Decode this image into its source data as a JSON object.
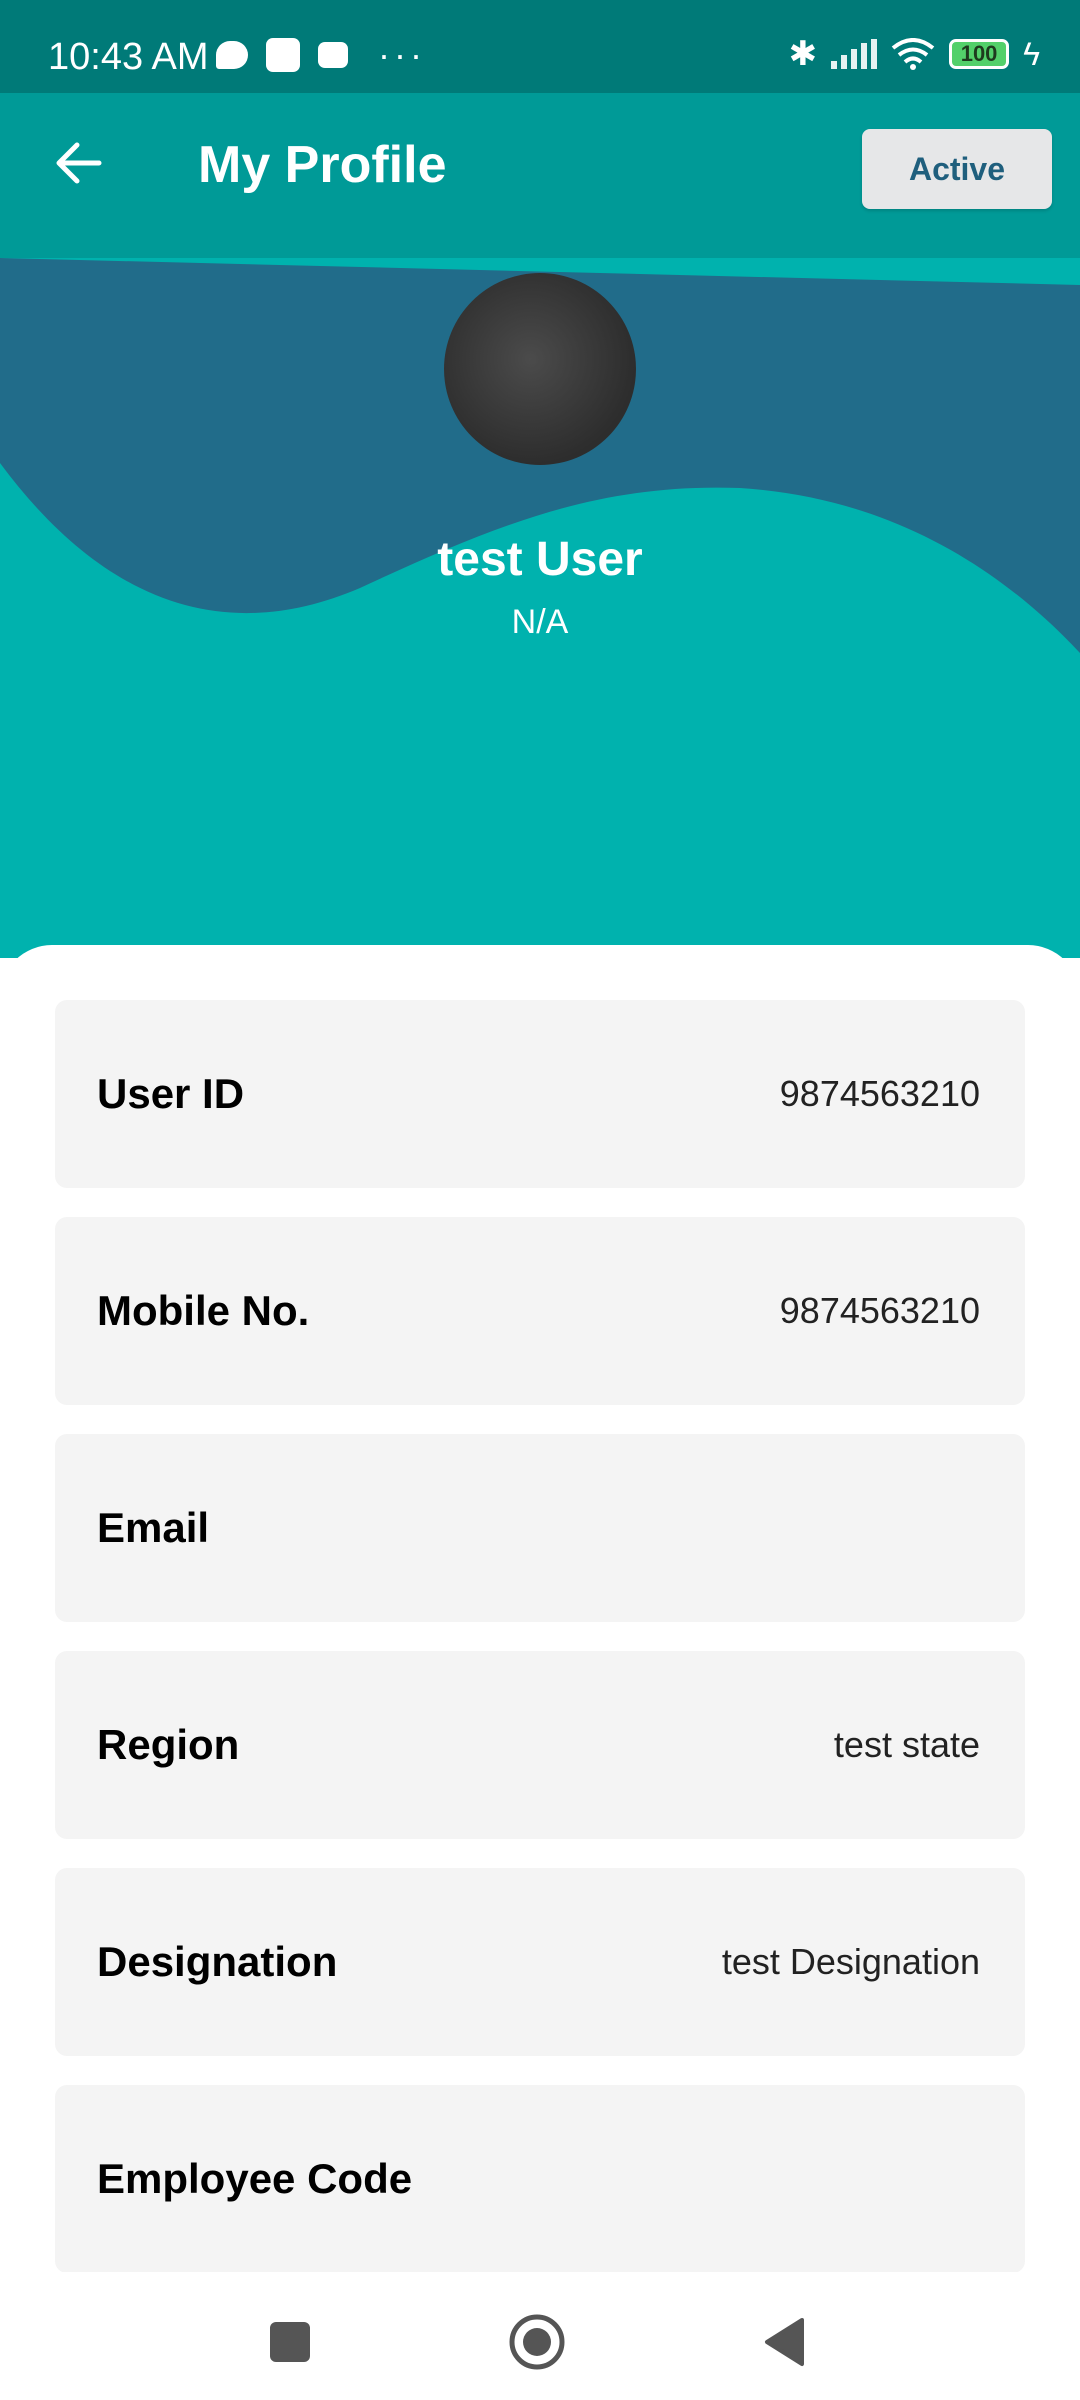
{
  "status_bar": {
    "time": "10:43 AM",
    "battery_level": "100",
    "icons": [
      "chat-bubble-icon",
      "image-icon",
      "calendar-icon",
      "more-dots-icon",
      "bluetooth-icon",
      "signal-icon",
      "wifi-icon",
      "battery-icon",
      "charging-bolt-icon"
    ]
  },
  "app_bar": {
    "title": "My Profile",
    "status_label": "Active",
    "back_icon": "arrow-left-icon"
  },
  "profile": {
    "name": "test User",
    "subtitle": "N/A"
  },
  "fields": [
    {
      "label": "User ID",
      "value": "9874563210"
    },
    {
      "label": "Mobile No.",
      "value": "9874563210"
    },
    {
      "label": "Email",
      "value": ""
    },
    {
      "label": "Region",
      "value": "test state"
    },
    {
      "label": "Designation",
      "value": "test Designation"
    },
    {
      "label": "Employee Code",
      "value": ""
    }
  ],
  "colors": {
    "status_bar": "#007a78",
    "app_bar": "#009a97",
    "teal": "#00b2ae",
    "wave_blue": "#216c8a",
    "chip_text": "#1f5f7d"
  },
  "nav_bar": {
    "icons": [
      "recent-apps-icon",
      "home-icon",
      "back-triangle-icon"
    ]
  }
}
